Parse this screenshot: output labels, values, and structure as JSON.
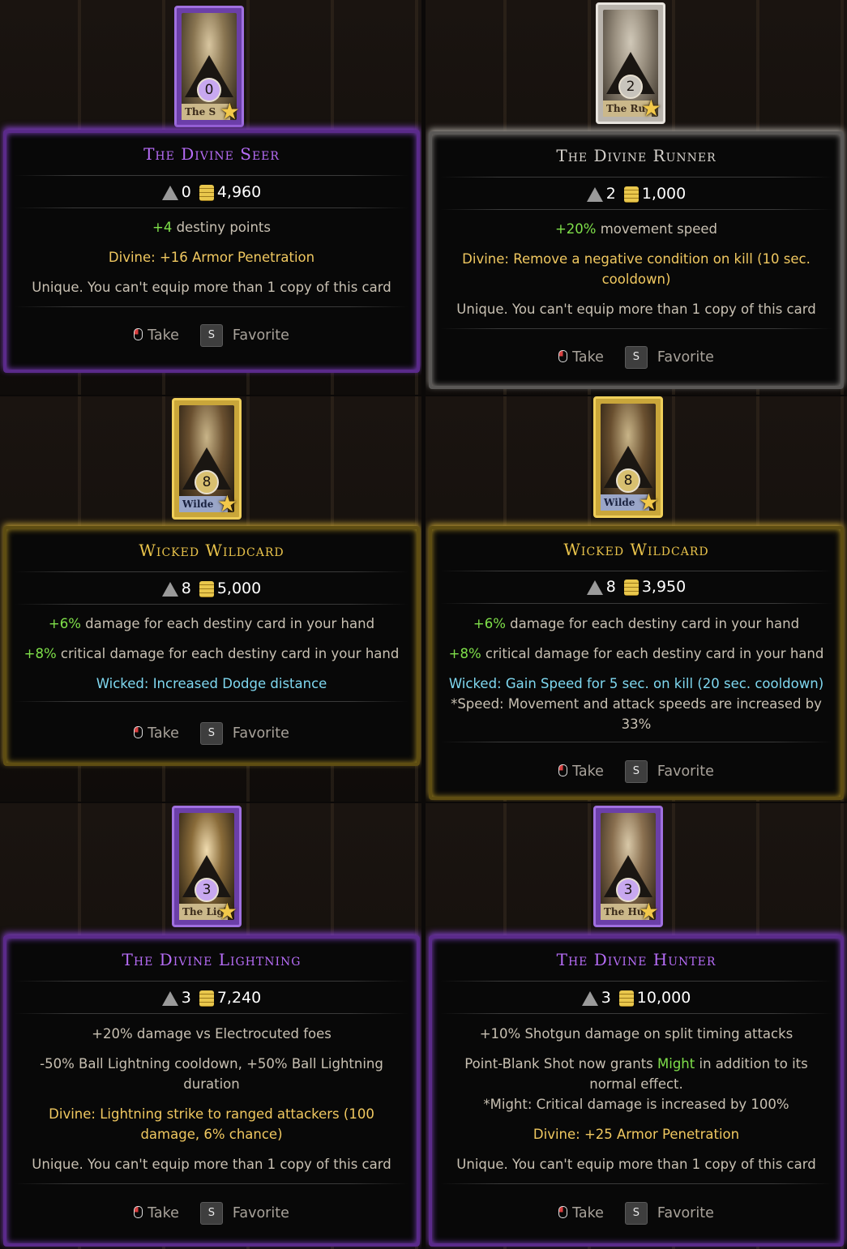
{
  "colors": {
    "purple": "#b66cf6",
    "silver": "#d6d2cc",
    "gold": "#e8c24a",
    "green": "#7fe04a",
    "divine": "#f0c860",
    "wicked": "#7fd8f0"
  },
  "icons": {
    "cost": "destiny-triangle-icon",
    "price": "gold-coins-icon",
    "take": "mouse-left-click-icon",
    "favorite": "key-s-icon",
    "rarity": "star-icon"
  },
  "cards": [
    {
      "title": "The Divine Seer",
      "rarity": "purple",
      "cost": "0",
      "price": "4,960",
      "art_cost": "0",
      "art_name": "The S",
      "lines": [
        {
          "type": "normal",
          "hl": "+4",
          "text": " destiny points"
        },
        {
          "type": "divine",
          "text": "Divine: +16 Armor Penetration"
        },
        {
          "type": "note",
          "text": "Unique. You can't equip more than 1 copy of this card"
        }
      ],
      "take": "Take",
      "key": "S",
      "favorite": "Favorite"
    },
    {
      "title": "The Divine Runner",
      "rarity": "silver",
      "cost": "2",
      "price": "1,000",
      "art_cost": "2",
      "art_name": "The Ru",
      "lines": [
        {
          "type": "normal",
          "hl": "+20%",
          "text": " movement speed"
        },
        {
          "type": "divine",
          "text": "Divine: Remove a negative condition on kill (10 sec. cooldown)"
        },
        {
          "type": "note",
          "text": "Unique. You can't equip more than 1 copy of this card"
        }
      ],
      "take": "Take",
      "key": "S",
      "favorite": "Favorite"
    },
    {
      "title": "Wicked Wildcard",
      "rarity": "gold",
      "cost": "8",
      "price": "5,000",
      "art_cost": "8",
      "art_name": "Wilde",
      "lines": [
        {
          "type": "normal",
          "hl": "+6%",
          "text": " damage for each destiny card in your hand"
        },
        {
          "type": "normal",
          "hl": "+8%",
          "text": " critical damage for each destiny card in your hand"
        },
        {
          "type": "wicked",
          "text": "Wicked: Increased Dodge distance"
        }
      ],
      "take": "Take",
      "key": "S",
      "favorite": "Favorite"
    },
    {
      "title": "Wicked Wildcard",
      "rarity": "gold",
      "cost": "8",
      "price": "3,950",
      "art_cost": "8",
      "art_name": "Wilde",
      "lines": [
        {
          "type": "normal",
          "hl": "+6%",
          "text": " damage for each destiny card in your hand"
        },
        {
          "type": "normal",
          "hl": "+8%",
          "text": " critical damage for each destiny card in your hand"
        },
        {
          "type": "wicked",
          "text": "Wicked: Gain Speed for 5 sec. on kill (20 sec. cooldown)"
        },
        {
          "type": "note",
          "text": "*Speed: Movement and attack speeds are increased by 33%"
        }
      ],
      "take": "Take",
      "key": "S",
      "favorite": "Favorite"
    },
    {
      "title": "The Divine Lightning",
      "rarity": "purple",
      "cost": "3",
      "price": "7,240",
      "art_cost": "3",
      "art_name": "The Ligh",
      "lines": [
        {
          "type": "note",
          "text": "+20% damage vs Electrocuted foes"
        },
        {
          "type": "note",
          "text": "-50% Ball Lightning cooldown, +50% Ball Lightning duration"
        },
        {
          "type": "divine",
          "text": "Divine: Lightning strike to ranged attackers (100 damage, 6% chance)"
        },
        {
          "type": "note",
          "text": "Unique. You can't equip more than 1 copy of this card"
        }
      ],
      "take": "Take",
      "key": "S",
      "favorite": "Favorite"
    },
    {
      "title": "The Divine Hunter",
      "rarity": "purple",
      "cost": "3",
      "price": "10,000",
      "art_cost": "3",
      "art_name": "The Hu",
      "lines": [
        {
          "type": "note",
          "text": "+10% Shotgun damage on split timing attacks"
        },
        {
          "type": "might",
          "pre": "Point-Blank Shot now grants ",
          "hl": "Might",
          "text": " in addition to its normal effect."
        },
        {
          "type": "note",
          "text": "*Might: Critical damage is increased by 100%"
        },
        {
          "type": "divine",
          "text": "Divine: +25 Armor Penetration"
        },
        {
          "type": "note",
          "text": "Unique. You can't equip more than 1 copy of this card"
        }
      ],
      "take": "Take",
      "key": "S",
      "favorite": "Favorite"
    }
  ]
}
